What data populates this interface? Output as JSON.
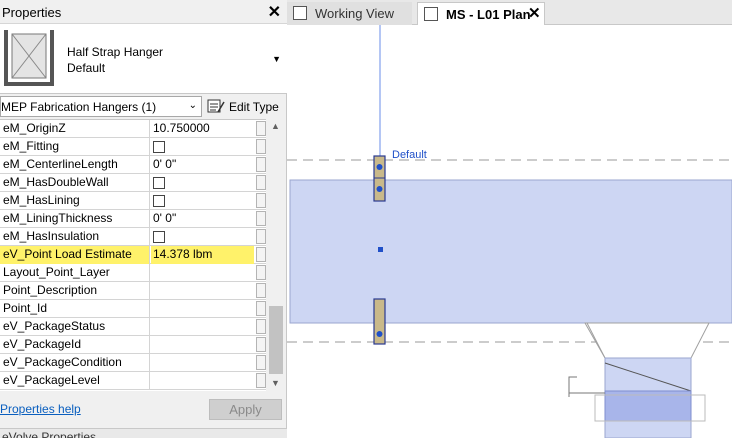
{
  "properties": {
    "title": "Properties",
    "type_name": "Half Strap Hanger",
    "type_sub": "Default",
    "filter_value": "MEP Fabrication Hangers (1)",
    "edit_type_label": "Edit Type",
    "rows": [
      {
        "name": "eM_OriginZ",
        "value": "10.750000",
        "checkbox": false
      },
      {
        "name": "eM_Fitting",
        "value": "",
        "checkbox": true
      },
      {
        "name": "eM_CenterlineLength",
        "value": "0'  0\"",
        "checkbox": false
      },
      {
        "name": "eM_HasDoubleWall",
        "value": "",
        "checkbox": true
      },
      {
        "name": "eM_HasLining",
        "value": "",
        "checkbox": true
      },
      {
        "name": "eM_LiningThickness",
        "value": "0'  0\"",
        "checkbox": false
      },
      {
        "name": "eM_HasInsulation",
        "value": "",
        "checkbox": true
      },
      {
        "name": "eV_Point Load Estimate",
        "value": "14.378 lbm",
        "checkbox": false,
        "highlight": true
      },
      {
        "name": "Layout_Point_Layer",
        "value": "",
        "checkbox": false
      },
      {
        "name": "Point_Description",
        "value": "",
        "checkbox": false
      },
      {
        "name": "Point_Id",
        "value": "",
        "checkbox": false
      },
      {
        "name": "eV_PackageStatus",
        "value": "",
        "checkbox": false
      },
      {
        "name": "eV_PackageId",
        "value": "",
        "checkbox": false
      },
      {
        "name": "eV_PackageCondition",
        "value": "",
        "checkbox": false
      },
      {
        "name": "eV_PackageLevel",
        "value": "",
        "checkbox": false
      }
    ],
    "help_label": "Properties help",
    "apply_label": "Apply",
    "next_panel_title": "eVolve Properties"
  },
  "tabs": [
    {
      "label": "Working View",
      "active": false
    },
    {
      "label": "MS - L01 Plan",
      "active": true
    }
  ],
  "view": {
    "level_label": "Default",
    "highlight_color": "#fff26a",
    "duct_fill": "#cdd6f3",
    "accent_blue": "#2050c8"
  }
}
